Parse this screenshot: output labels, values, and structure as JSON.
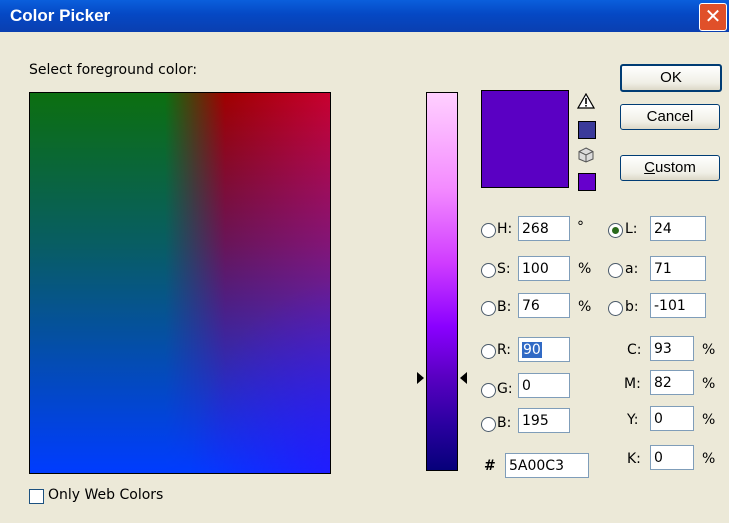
{
  "window": {
    "title": "Color Picker",
    "close_label": "✕"
  },
  "prompt": "Select foreground color:",
  "buttons": {
    "ok": "OK",
    "cancel": "Cancel",
    "custom": "Custom"
  },
  "colors": {
    "current": "#5a00c3",
    "gamut_warning_swatch": "#3a3a9a",
    "web_safe_swatch": "#6600cc"
  },
  "icons": {
    "gamut_warning": "warning-triangle-icon",
    "web_safe": "cube-icon"
  },
  "hsb": {
    "h": {
      "label": "H:",
      "value": "268",
      "unit": "°"
    },
    "s": {
      "label": "S:",
      "value": "100",
      "unit": "%"
    },
    "b": {
      "label": "B:",
      "value": "76",
      "unit": "%"
    }
  },
  "lab": {
    "l": {
      "label": "L:",
      "value": "24"
    },
    "a": {
      "label": "a:",
      "value": "71"
    },
    "b": {
      "label": "b:",
      "value": "-101"
    }
  },
  "rgb": {
    "r": {
      "label": "R:",
      "value": "90"
    },
    "g": {
      "label": "G:",
      "value": "0"
    },
    "b": {
      "label": "B:",
      "value": "195"
    }
  },
  "cmyk": {
    "c": {
      "label": "C:",
      "value": "93",
      "unit": "%"
    },
    "m": {
      "label": "M:",
      "value": "82",
      "unit": "%"
    },
    "y": {
      "label": "Y:",
      "value": "0",
      "unit": "%"
    },
    "k": {
      "label": "K:",
      "value": "0",
      "unit": "%"
    }
  },
  "hex": {
    "label": "#",
    "value": "5A00C3"
  },
  "web_colors": {
    "label": "Only Web Colors",
    "checked": false
  }
}
